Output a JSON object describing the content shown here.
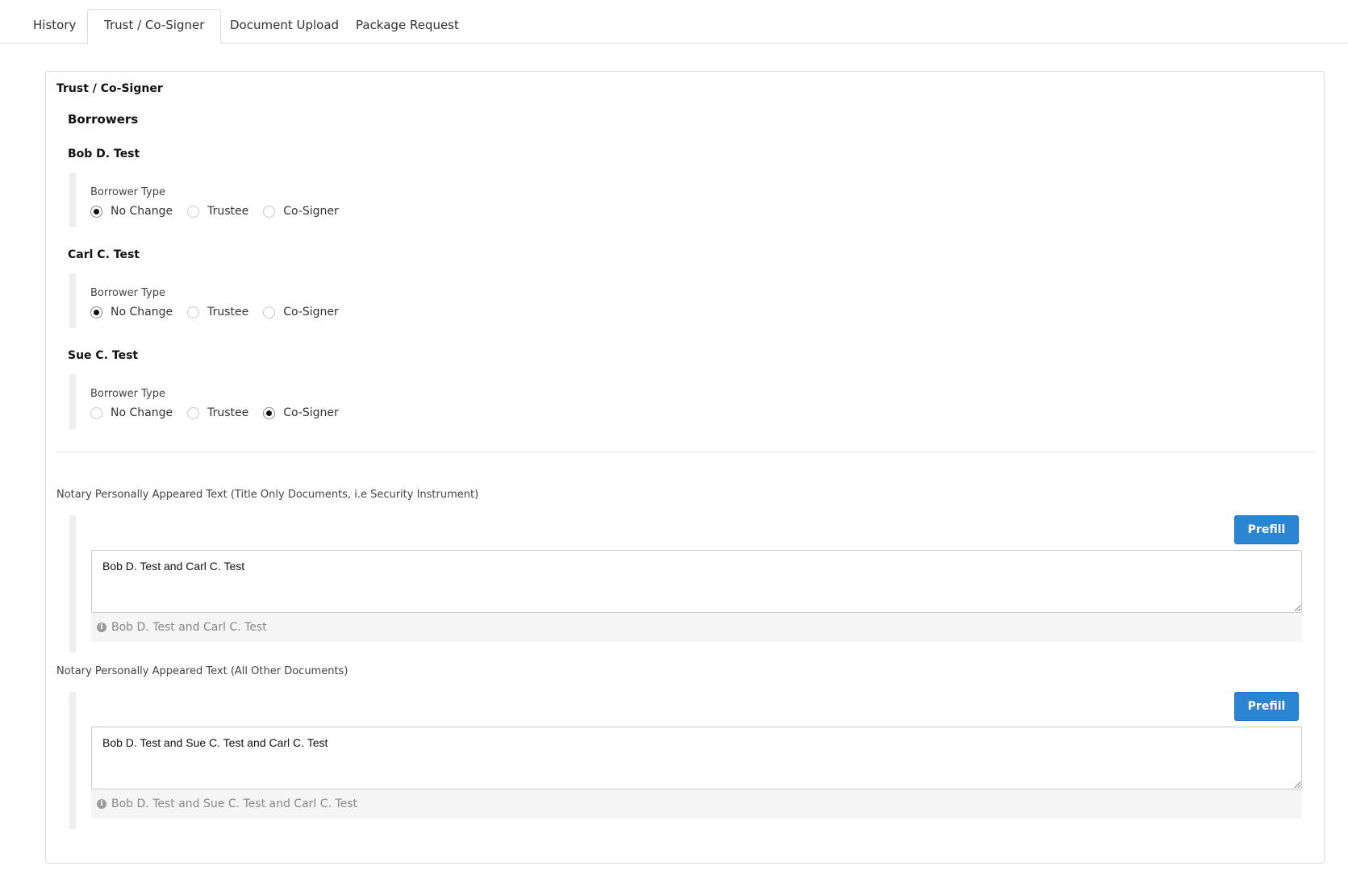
{
  "tabs": [
    {
      "label": "History",
      "active": false
    },
    {
      "label": "Trust / Co-Signer",
      "active": true
    },
    {
      "label": "Document Upload",
      "active": false
    },
    {
      "label": "Package Request",
      "active": false
    }
  ],
  "panel": {
    "title": "Trust / Co-Signer",
    "borrowers_heading": "Borrowers",
    "borrowers": [
      {
        "name": "Bob D. Test",
        "type_label": "Borrower Type",
        "options": [
          "No Change",
          "Trustee",
          "Co-Signer"
        ],
        "selected": "No Change"
      },
      {
        "name": "Carl C. Test",
        "type_label": "Borrower Type",
        "options": [
          "No Change",
          "Trustee",
          "Co-Signer"
        ],
        "selected": "No Change"
      },
      {
        "name": "Sue C. Test",
        "type_label": "Borrower Type",
        "options": [
          "No Change",
          "Trustee",
          "Co-Signer"
        ],
        "selected": "Co-Signer"
      }
    ],
    "notary_title_only": {
      "label": "Notary Personally Appeared Text (Title Only Documents, i.e Security Instrument)",
      "prefill_label": "Prefill",
      "value": "Bob D. Test and Carl C. Test",
      "hint": "Bob D. Test and Carl C. Test"
    },
    "notary_all_other": {
      "label": "Notary Personally Appeared Text (All Other Documents)",
      "prefill_label": "Prefill",
      "value": "Bob D. Test and Sue C. Test and Carl C. Test",
      "hint": "Bob D. Test and Sue C. Test and Carl C. Test"
    }
  },
  "colors": {
    "primary_button": "#2a85d3",
    "border": "#dddddd",
    "hint_background": "#f5f5f5"
  },
  "icons": {
    "hint_icon": "info-icon",
    "radio_icon": "radio-circle-icon"
  }
}
